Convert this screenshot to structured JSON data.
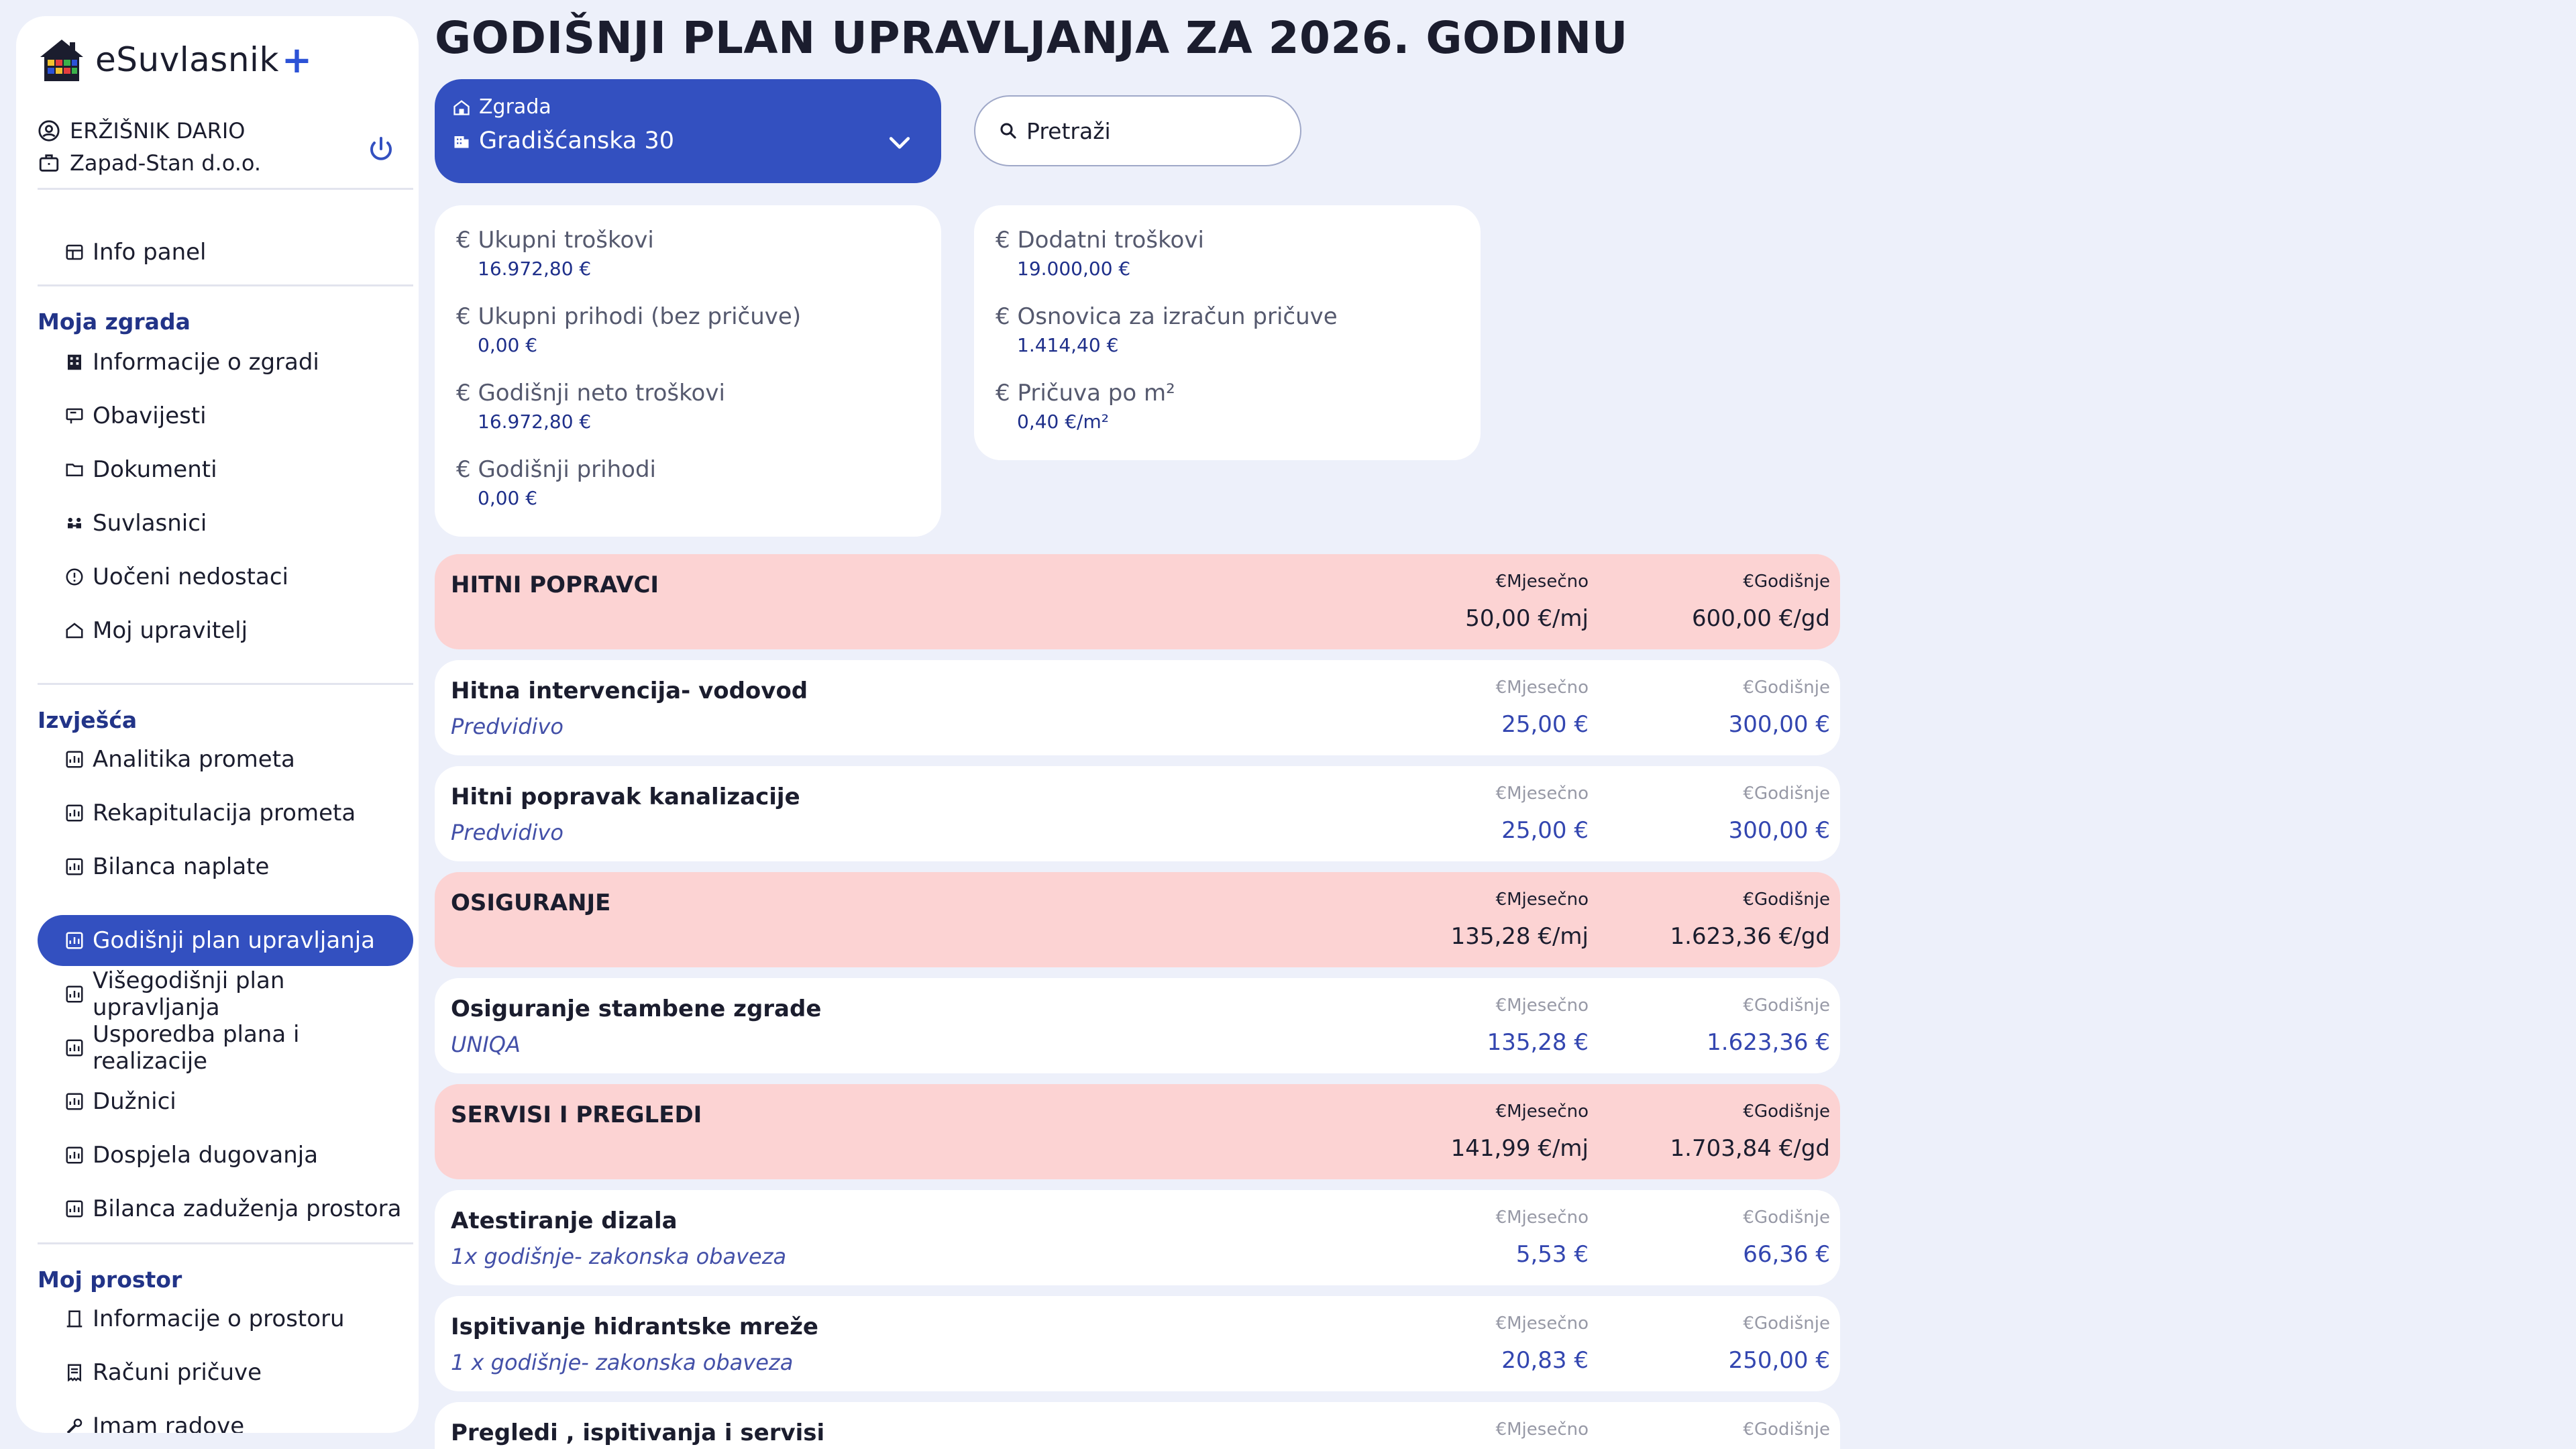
{
  "brand": {
    "name": "eSuvlasnik",
    "plus": "+"
  },
  "user": {
    "name": "ERŽIŠNIK DARIO",
    "company": "Zapad-Stan d.o.o."
  },
  "sidebar": {
    "info_panel": "Info panel",
    "sections": [
      {
        "title": "Moja zgrada",
        "items": [
          "Informacije o zgradi",
          "Obavijesti",
          "Dokumenti",
          "Suvlasnici",
          "Uočeni nedostaci",
          "Moj upravitelj"
        ]
      },
      {
        "title": "Izvješća",
        "items": [
          "Analitika prometa",
          "Rekapitulacija prometa",
          "Bilanca naplate",
          "Godišnji plan upravljanja",
          "Višegodišnji plan upravljanja",
          "Usporedba plana i realizacije",
          "Dužnici",
          "Dospjela dugovanja",
          "Bilanca zaduženja prostora"
        ]
      },
      {
        "title": "Moj prostor",
        "items": [
          "Informacije o prostoru",
          "Računi pričuve",
          "Imam radove"
        ]
      }
    ],
    "active_item": "Godišnji plan upravljanja"
  },
  "page": {
    "title": "GODIŠNJI PLAN UPRAVLJANJA ZA 2026. GODINU"
  },
  "building_select": {
    "label": "Zgrada",
    "value": "Gradišćanska 30"
  },
  "search": {
    "placeholder": "Pretraži"
  },
  "summary_left": [
    {
      "label": "Ukupni troškovi",
      "value": "16.972,80 €"
    },
    {
      "label": "Ukupni prihodi (bez pričuve)",
      "value": "0,00 €"
    },
    {
      "label": "Godišnji neto troškovi",
      "value": "16.972,80 €"
    },
    {
      "label": "Godišnji prihodi",
      "value": "0,00 €"
    }
  ],
  "summary_right": [
    {
      "label": "Dodatni troškovi",
      "value": "19.000,00 €"
    },
    {
      "label": "Osnovica za izračun pričuve",
      "value": "1.414,40 €"
    },
    {
      "label": "Pričuva po m²",
      "value": "0,40 €/m²"
    }
  ],
  "currency_symbol": "€",
  "columns": {
    "monthly": "Mjesečno",
    "yearly": "Godišnje"
  },
  "rows": [
    {
      "kind": "category",
      "title": "HITNI POPRAVCI",
      "monthly": "50,00 €/mj",
      "yearly": "600,00 €/gd"
    },
    {
      "kind": "item",
      "title": "Hitna intervencija- vodovod",
      "subtitle": "Predvidivo",
      "monthly": "25,00 €",
      "yearly": "300,00 €"
    },
    {
      "kind": "item",
      "title": "Hitni popravak kanalizacije",
      "subtitle": "Predvidivo",
      "monthly": "25,00 €",
      "yearly": "300,00 €"
    },
    {
      "kind": "category",
      "title": "OSIGURANJE",
      "monthly": "135,28 €/mj",
      "yearly": "1.623,36 €/gd"
    },
    {
      "kind": "item",
      "title": "Osiguranje stambene zgrade",
      "subtitle": "UNIQA",
      "monthly": "135,28 €",
      "yearly": "1.623,36 €"
    },
    {
      "kind": "category",
      "title": "SERVISI I PREGLEDI",
      "monthly": "141,99 €/mj",
      "yearly": "1.703,84 €/gd"
    },
    {
      "kind": "item",
      "title": "Atestiranje dizala",
      "subtitle": "1x godišnje- zakonska obaveza",
      "monthly": "5,53 €",
      "yearly": "66,36 €"
    },
    {
      "kind": "item",
      "title": "Ispitivanje hidrantske mreže",
      "subtitle": "1 x godišnje- zakonska obaveza",
      "monthly": "20,83 €",
      "yearly": "250,00 €"
    },
    {
      "kind": "item",
      "title": "Pregledi , ispitivanja i servisi",
      "subtitle": "",
      "monthly": "",
      "yearly": ""
    }
  ],
  "colors": {
    "accent": "#3350c0",
    "category_bg": "#fcd3d3",
    "page_bg": "#edf0fa",
    "section_title": "#223488"
  }
}
